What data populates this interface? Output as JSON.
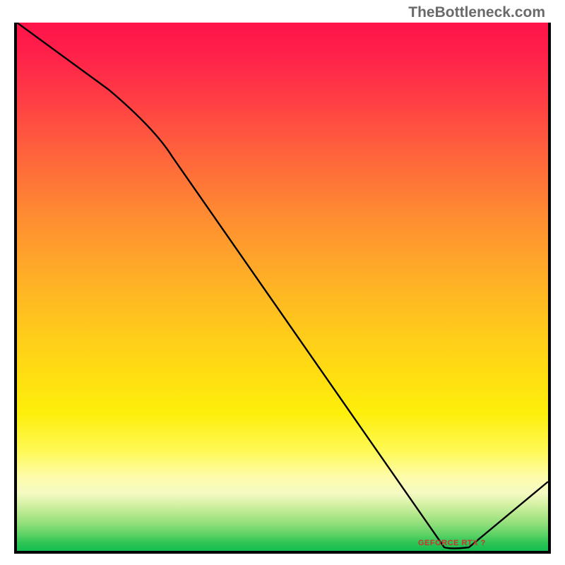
{
  "watermark": "TheBottleneck.com",
  "chart_data": {
    "type": "line",
    "title": "",
    "xlabel": "",
    "ylabel": "",
    "x": [
      0,
      0.28,
      0.83,
      0.85,
      1.0
    ],
    "values": [
      1.0,
      0.79,
      0.003,
      0.003,
      0.13
    ],
    "xlim": [
      0,
      1
    ],
    "ylim": [
      0,
      1
    ],
    "background": "rainbow-gradient-red-to-green",
    "annotations": [
      {
        "text_approx": "GEFORCE RTX ?",
        "x": 0.82,
        "y": 0.012
      }
    ]
  },
  "colors": {
    "gradient_top": "#ff1449",
    "gradient_bottom": "#14bd4f",
    "line": "#000000",
    "border": "#000000",
    "annotation": "#cc3030"
  }
}
